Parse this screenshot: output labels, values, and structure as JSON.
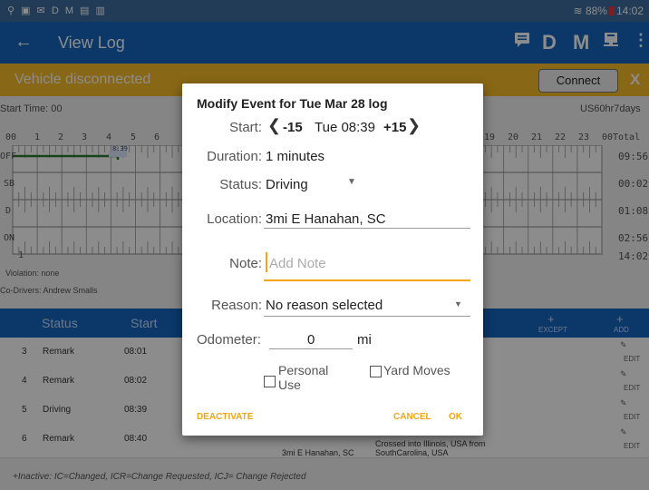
{
  "statusbar": {
    "left_icons": "⚲ ▣ ✉ D M ▤ ▥",
    "battery": "88%",
    "time": "14:02"
  },
  "appbar": {
    "back_icon": "←",
    "title": "View Log",
    "actions": [
      "D",
      "M"
    ]
  },
  "banner": {
    "message": "Vehicle disconnected",
    "connect_label": "Connect",
    "close_label": "X"
  },
  "log": {
    "start_time": "Start Time: 00",
    "cycle": "US60hr7days",
    "hours_left": [
      "00",
      "1",
      "2",
      "3",
      "4",
      "5",
      "6"
    ],
    "hours_right": [
      "19",
      "20",
      "21",
      "22",
      "23",
      "00"
    ],
    "total_label": "Total",
    "rows": [
      "OFF",
      "SB",
      "D",
      "ON"
    ],
    "totals": [
      "09:56",
      "00:02",
      "01:08",
      "02:56"
    ],
    "grand_total": "14:02",
    "marker": "8:39",
    "tick_below": "1",
    "violation": "Violation: none",
    "codrivers": "Co-Drivers: Andrew Smalls"
  },
  "table": {
    "headers": {
      "status": "Status",
      "start": "Start",
      "except": "EXCEPT",
      "add": "ADD"
    },
    "rows": [
      {
        "n": "3",
        "status": "Remark",
        "start": "08:01",
        "location": "",
        "note": ""
      },
      {
        "n": "4",
        "status": "Remark",
        "start": "08:02",
        "location": "",
        "note": ""
      },
      {
        "n": "5",
        "status": "Driving",
        "start": "08:39",
        "location": "",
        "note": ""
      },
      {
        "n": "6",
        "status": "Remark",
        "start": "08:40",
        "location": "3mi E Hanahan, SC",
        "note": "Crossed into Illinois, USA from SouthCarolina, USA"
      }
    ],
    "edit_label": "EDIT",
    "footnote": "+Inactive: IC=Changed, ICR=Change Requested, ICJ= Change Rejected"
  },
  "dialog": {
    "title": "Modify Event for Tue Mar 28 log",
    "start_label": "Start:",
    "minus": "-15",
    "start_value": "Tue 08:39",
    "plus": "+15",
    "duration_label": "Duration:",
    "duration_value": "1 minutes",
    "status_label": "Status:",
    "status_value": "Driving",
    "location_label": "Location:",
    "location_value": "3mi E Hanahan, SC",
    "note_label": "Note:",
    "note_placeholder": "Add Note",
    "reason_label": "Reason:",
    "reason_value": "No reason selected",
    "odometer_label": "Odometer:",
    "odometer_value": "0",
    "odometer_unit": "mi",
    "personal_use": "Personal Use",
    "personal_1": "Personal",
    "personal_2": "Use",
    "yard_moves": "Yard Moves",
    "deactivate": "DEACTIVATE",
    "cancel": "CANCEL",
    "ok": "OK"
  },
  "colors": {
    "accent": "#1565c0",
    "banner": "#f7bd29",
    "driving_line": "#2e7d32",
    "button": "#f5a511"
  }
}
